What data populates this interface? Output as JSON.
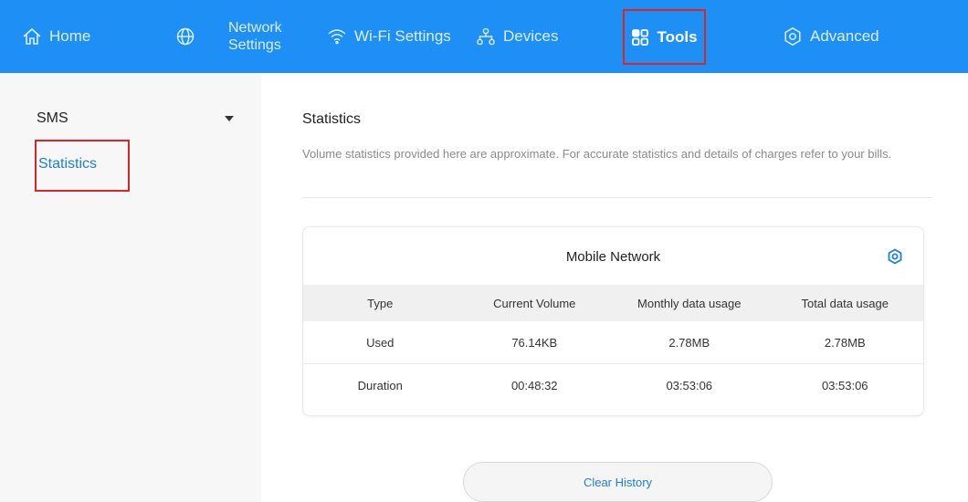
{
  "nav": {
    "home": "Home",
    "network_settings": "Network\nSettings",
    "wifi_settings": "Wi-Fi Settings",
    "devices": "Devices",
    "tools": "Tools",
    "advanced": "Advanced"
  },
  "sidebar": {
    "group_label": "SMS",
    "items": [
      {
        "label": "Statistics",
        "selected": true
      }
    ]
  },
  "main": {
    "title": "Statistics",
    "description": "Volume statistics provided here are approximate. For accurate statistics and details of charges refer to your bills."
  },
  "card": {
    "title": "Mobile Network",
    "columns": [
      "Type",
      "Current Volume",
      "Monthly data usage",
      "Total data usage"
    ],
    "rows": [
      [
        "Used",
        "76.14KB",
        "2.78MB",
        "2.78MB"
      ],
      [
        "Duration",
        "00:48:32",
        "03:53:06",
        "03:53:06"
      ]
    ]
  },
  "clear_button": "Clear History",
  "colors": {
    "nav_background": "#1e90f5",
    "accent_link": "#1e7fd8",
    "highlight_box": "#d9262b"
  },
  "icons": [
    "home-icon",
    "globe-icon",
    "wifi-icon",
    "devices-icon",
    "tools-icon",
    "advanced-gear-icon",
    "dropdown-caret-icon",
    "settings-gear-icon"
  ]
}
